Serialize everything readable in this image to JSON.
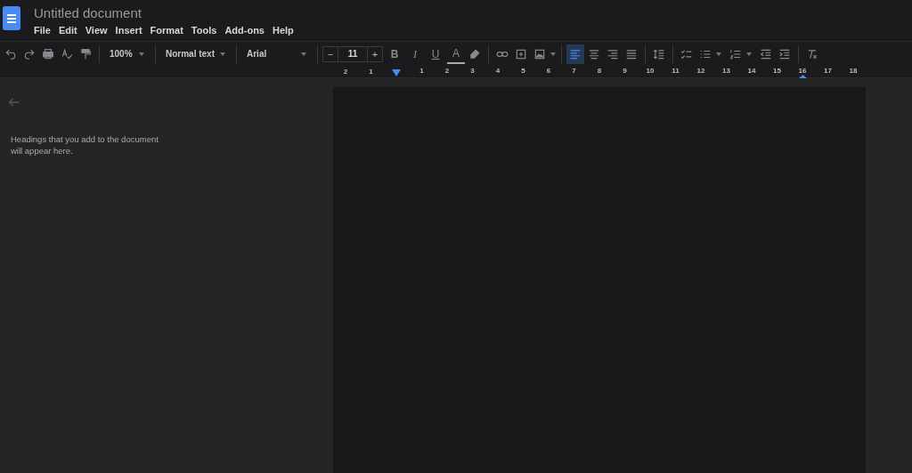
{
  "app": {
    "title": "Untitled document",
    "menu": [
      "File",
      "Edit",
      "View",
      "Insert",
      "Format",
      "Tools",
      "Add-ons",
      "Help"
    ]
  },
  "toolbar": {
    "zoom": "100%",
    "style": "Normal text",
    "font": "Arial",
    "font_size": {
      "minus": "−",
      "value": "11",
      "plus": "+"
    },
    "format_buttons": [
      "B",
      "I",
      "U",
      "A"
    ],
    "alignment": [
      {
        "selected": true
      },
      {
        "selected": false
      },
      {
        "selected": false
      },
      {
        "selected": false
      }
    ]
  },
  "ruler": {
    "left_labels": [
      "2",
      "1"
    ],
    "labels": [
      "1",
      "2",
      "3",
      "4",
      "5",
      "6",
      "7",
      "8",
      "9",
      "10",
      "11",
      "12",
      "13",
      "14",
      "15",
      "16",
      "17",
      "18"
    ]
  },
  "outline": {
    "hint": "Headings that you add to the document will appear here."
  }
}
